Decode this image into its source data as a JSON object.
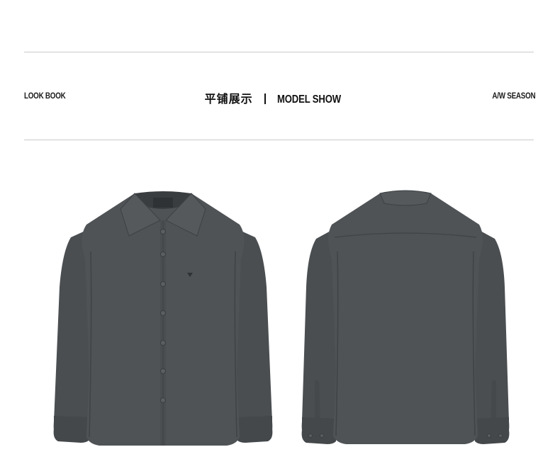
{
  "header": {
    "left_label": "LOOK BOOK",
    "center_cn": "平铺展示",
    "center_en": "MODEL SHOW",
    "right_label": "A/W SEASON"
  },
  "product": {
    "color": "#4f5356",
    "color_dark": "#3d4144",
    "views": [
      "front",
      "back"
    ]
  }
}
